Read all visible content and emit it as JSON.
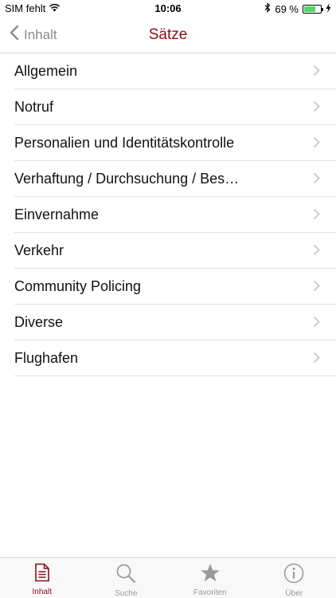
{
  "status_bar": {
    "carrier": "SIM fehlt",
    "time": "10:06",
    "battery_percent_label": "69 %",
    "battery_level": 0.69
  },
  "nav": {
    "back_label": "Inhalt",
    "title": "Sätze"
  },
  "list": {
    "items": [
      {
        "label": "Allgemein"
      },
      {
        "label": "Notruf"
      },
      {
        "label": "Personalien und Identitätskontrolle"
      },
      {
        "label": "Verhaftung / Durchsuchung / Bes…"
      },
      {
        "label": "Einvernahme"
      },
      {
        "label": "Verkehr"
      },
      {
        "label": "Community Policing"
      },
      {
        "label": "Diverse"
      },
      {
        "label": "Flughafen"
      }
    ]
  },
  "tab_bar": {
    "tabs": [
      {
        "label": "Inhalt",
        "icon": "document-icon",
        "active": true
      },
      {
        "label": "Suche",
        "icon": "search-icon",
        "active": false
      },
      {
        "label": "Favoriten",
        "icon": "star-icon",
        "active": false
      },
      {
        "label": "Über",
        "icon": "info-icon",
        "active": false
      }
    ]
  },
  "colors": {
    "accent": "#8b0e1a",
    "inactive": "#999999",
    "battery": "#4cd964"
  }
}
